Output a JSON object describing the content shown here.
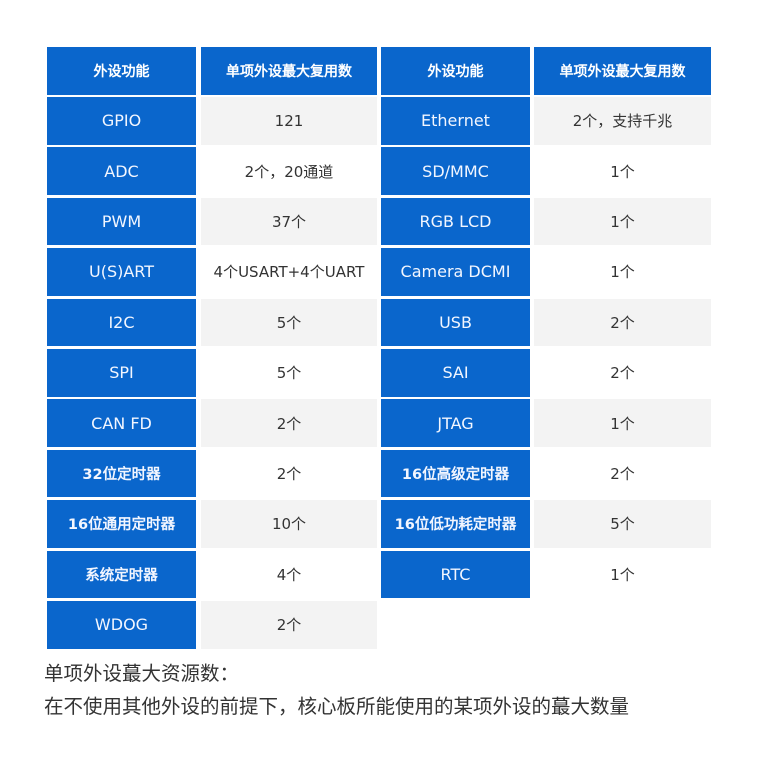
{
  "table": {
    "headers": [
      "外设功能",
      "单项外设蕞大复用数",
      "外设功能",
      "单项外设蕞大复用数"
    ],
    "left_rows": [
      {
        "feature": "GPIO",
        "count": "121"
      },
      {
        "feature": "ADC",
        "count": "2个，20通道"
      },
      {
        "feature": "PWM",
        "count": "37个"
      },
      {
        "feature": "U(S)ART",
        "count": "4个USART+4个UART"
      },
      {
        "feature": "I2C",
        "count": "5个"
      },
      {
        "feature": "SPI",
        "count": "5个"
      },
      {
        "feature": "CAN FD",
        "count": "2个"
      },
      {
        "feature": "32位定时器",
        "count": "2个"
      },
      {
        "feature": "16位通用定时器",
        "count": "10个"
      },
      {
        "feature": "系统定时器",
        "count": "4个"
      },
      {
        "feature": "WDOG",
        "count": "2个"
      }
    ],
    "right_rows": [
      {
        "feature": "Ethernet",
        "count": "2个，支持千兆"
      },
      {
        "feature": "SD/MMC",
        "count": "1个"
      },
      {
        "feature": "RGB LCD",
        "count": "1个"
      },
      {
        "feature": "Camera DCMI",
        "count": "1个"
      },
      {
        "feature": "USB",
        "count": "2个"
      },
      {
        "feature": "SAI",
        "count": "2个"
      },
      {
        "feature": "JTAG",
        "count": "1个"
      },
      {
        "feature": "16位高级定时器",
        "count": "2个"
      },
      {
        "feature": "16位低功耗定时器",
        "count": "5个"
      },
      {
        "feature": "RTC",
        "count": "1个"
      }
    ]
  },
  "note": {
    "title": "单项外设蕞大资源数：",
    "body": "在不使用其他外设的前提下，核心板所能使用的某项外设的蕞大数量"
  },
  "colors": {
    "header_bg": "#0a66cc",
    "label_bg": "#0a66cc",
    "row_shade": "#f3f3f3"
  }
}
